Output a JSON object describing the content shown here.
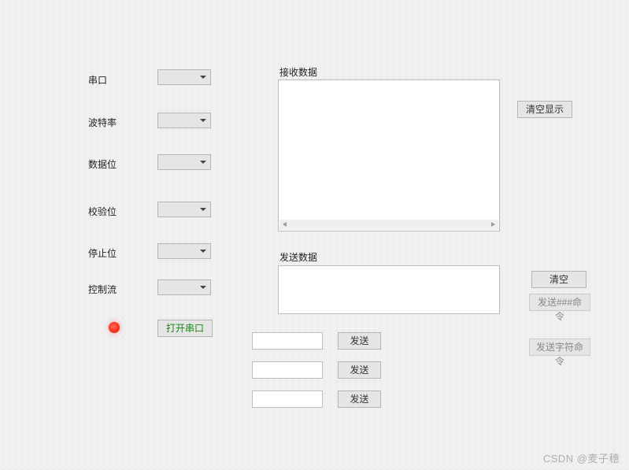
{
  "config": {
    "rows": [
      {
        "label": "串口",
        "value": ""
      },
      {
        "label": "波特率",
        "value": ""
      },
      {
        "label": "数据位",
        "value": ""
      },
      {
        "label": "校验位",
        "value": ""
      },
      {
        "label": "停止位",
        "value": ""
      },
      {
        "label": "控制流",
        "value": ""
      }
    ],
    "open_button": "打开串口"
  },
  "recv": {
    "title": "接收数据",
    "clear_button": "清空显示",
    "content": ""
  },
  "send": {
    "title": "发送数据",
    "content": "",
    "clear_button": "清空",
    "cmd_hash_button": "发送###命令",
    "cmd_char_button": "发送字符命令",
    "rows": [
      {
        "value": "",
        "button": "发送"
      },
      {
        "value": "",
        "button": "发送"
      },
      {
        "value": "",
        "button": "发送"
      }
    ]
  },
  "watermark": "CSDN @麦子穗"
}
